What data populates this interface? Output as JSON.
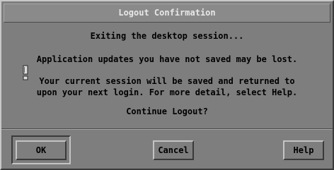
{
  "dialog": {
    "title": "Logout Confirmation",
    "messages": [
      "Exiting the desktop session...",
      "Application updates you have not saved may be lost.",
      "Your current session will be saved and returned to",
      "upon your next login.  For more detail, select Help.",
      "Continue Logout?"
    ],
    "icon": "exclamation-icon"
  },
  "buttons": {
    "ok": "OK",
    "cancel": "Cancel",
    "help": "Help"
  }
}
